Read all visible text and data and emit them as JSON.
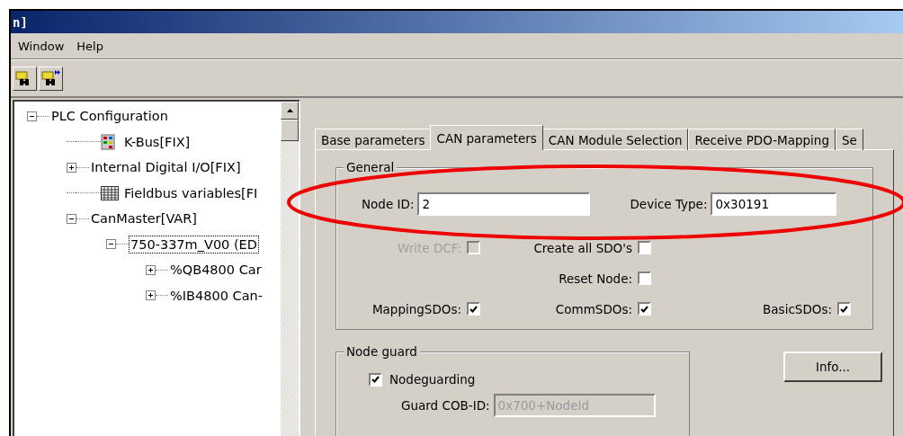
{
  "window": {
    "title": "n]"
  },
  "menu": [
    "Window",
    "Help"
  ],
  "toolbar": [
    {
      "kind": "scan"
    },
    {
      "kind": "scan-next"
    }
  ],
  "tree": [
    {
      "label": "PLC Configuration",
      "expanded": true,
      "selected": false,
      "children": [
        {
          "label": "K-Bus[FIX]",
          "kind": "module",
          "selected": false
        },
        {
          "label": "Internal Digital I/O[FIX]",
          "expanded": false,
          "selected": false
        },
        {
          "label": "Fieldbus variables[FI",
          "kind": "variables",
          "selected": false
        },
        {
          "label": "CanMaster[VAR]",
          "expanded": true,
          "selected": false,
          "children": [
            {
              "label": "750-337m_V00 (ED",
              "expanded": true,
              "selected": true,
              "children": [
                {
                  "label": "%QB4800 Car",
                  "expanded": false,
                  "selected": false
                },
                {
                  "label": "%IB4800 Can-",
                  "expanded": false,
                  "selected": false
                }
              ]
            }
          ]
        }
      ]
    }
  ],
  "tabs": [
    {
      "label": "Base parameters",
      "selected": false
    },
    {
      "label": "CAN parameters",
      "selected": true
    },
    {
      "label": "CAN Module Selection",
      "selected": false
    },
    {
      "label": "Receive PDO-Mapping",
      "selected": false
    },
    {
      "label": "Se",
      "selected": false
    }
  ],
  "general": {
    "title": "General",
    "node_id": {
      "label": "Node ID:",
      "value": "2"
    },
    "device_type": {
      "label": "Device Type:",
      "value": "0x30191"
    },
    "checkbox_rows": [
      [
        {
          "label": "Write DCF:",
          "checked": false,
          "disabled": true
        },
        {
          "label": "Create all SDO's",
          "checked": false,
          "disabled": false
        },
        null
      ],
      [
        null,
        {
          "label": "Reset Node:",
          "checked": false,
          "disabled": false
        },
        null
      ],
      [
        {
          "label": "MappingSDOs:",
          "checked": true,
          "disabled": false
        },
        {
          "label": "CommSDOs:",
          "checked": true,
          "disabled": false
        },
        {
          "label": "BasicSDOs:",
          "checked": true,
          "disabled": false
        }
      ]
    ]
  },
  "node_guard": {
    "title": "Node guard",
    "nodeguarding": {
      "label": "Nodeguarding",
      "checked": true
    },
    "guard_cob_id": {
      "label": "Guard COB-ID:",
      "value": "0x700+NodeId",
      "disabled": true
    }
  },
  "info_button": "Info..."
}
